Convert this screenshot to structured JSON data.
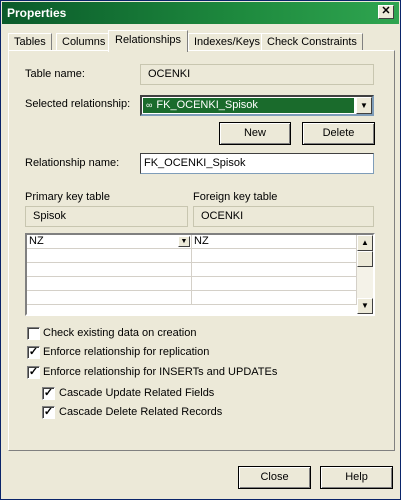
{
  "window": {
    "title": "Properties",
    "close_glyph": "✕"
  },
  "tabs": [
    {
      "label": "Tables"
    },
    {
      "label": "Columns"
    },
    {
      "label": "Relationships"
    },
    {
      "label": "Indexes/Keys"
    },
    {
      "label": "Check Constraints"
    }
  ],
  "form": {
    "table_name_label": "Table name:",
    "table_name_value": "OCENKI",
    "selected_relationship_label": "Selected relationship:",
    "selected_relationship_value": "FK_OCENKI_Spisok",
    "relationship_icon": "∞",
    "new_button": "New",
    "delete_button": "Delete",
    "relationship_name_label": "Relationship name:",
    "relationship_name_value": "FK_OCENKI_Spisok",
    "primary_key_table_label": "Primary key table",
    "primary_key_table_value": "Spisok",
    "foreign_key_table_label": "Foreign key table",
    "foreign_key_table_value": "OCENKI"
  },
  "grid": {
    "rows": [
      {
        "primary": "NZ",
        "foreign": "NZ"
      }
    ]
  },
  "options": [
    {
      "label": "Check existing data on creation",
      "checked": false
    },
    {
      "label": "Enforce relationship for replication",
      "checked": true
    },
    {
      "label": "Enforce relationship for INSERTs and UPDATEs",
      "checked": true
    },
    {
      "label": "Cascade Update Related Fields",
      "checked": true
    },
    {
      "label": "Cascade Delete Related Records",
      "checked": true
    }
  ],
  "footer": {
    "close_button": "Close",
    "help_button": "Help"
  },
  "colors": {
    "titlebar": "#1e8a3e",
    "selection": "#1a6b2c",
    "dialog_bg": "#ece9d8"
  }
}
